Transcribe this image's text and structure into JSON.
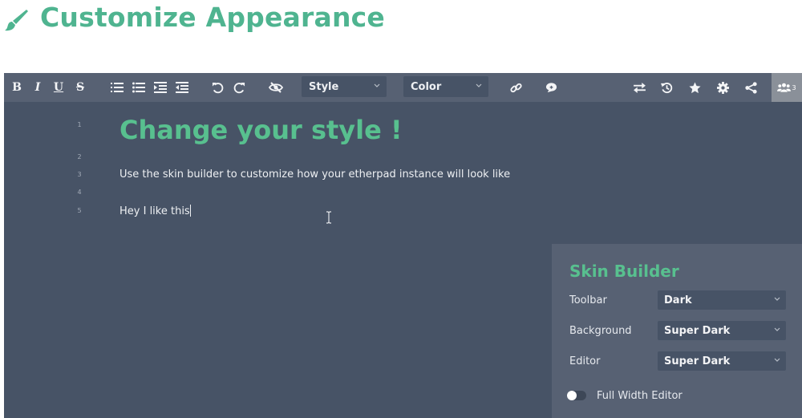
{
  "page": {
    "title": "Customize Appearance",
    "icon": "paintbrush-icon"
  },
  "colors": {
    "accent": "#4fb490",
    "editor_bg": "#475366",
    "toolbar_bg": "#576173",
    "text": "#eef0f3"
  },
  "toolbar": {
    "bold_label": "B",
    "italic_label": "I",
    "underline_label": "U",
    "strike_label": "S",
    "style_select": "Style",
    "color_select": "Color",
    "users_count": "3",
    "icons": [
      "ordered-list-icon",
      "unordered-list-icon",
      "indent-icon",
      "outdent-icon",
      "undo-icon",
      "redo-icon",
      "eye-slash-icon",
      "link-icon",
      "comment-icon",
      "import-export-icon",
      "history-icon",
      "star-icon",
      "gear-icon",
      "share-icon",
      "users-icon"
    ]
  },
  "editor": {
    "line_numbers": [
      "1",
      "2",
      "3",
      "4",
      "5"
    ],
    "heading": "Change your style !",
    "paragraph": "Use the skin builder to customize how your etherpad instance will look like",
    "line5": "Hey I like this"
  },
  "skin_builder": {
    "title": "Skin Builder",
    "toolbar_label": "Toolbar",
    "toolbar_value": "Dark",
    "background_label": "Background",
    "background_value": "Super Dark",
    "editor_label": "Editor",
    "editor_value": "Super Dark",
    "full_width_label": "Full Width Editor",
    "full_width_enabled": false
  }
}
